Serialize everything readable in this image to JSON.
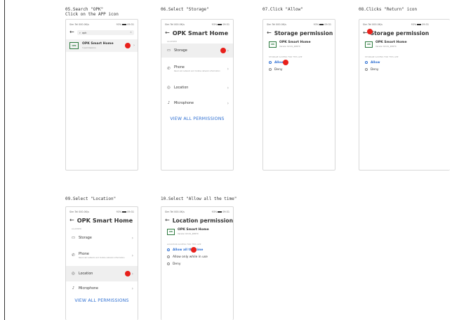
{
  "status_bar": {
    "left": "Sim Tel  000.0K/s",
    "right": "93%",
    "right_short": "93%"
  },
  "steps": [
    {
      "caption_lines": [
        "05.Search \"OPK\"",
        "Click on the APP icon"
      ],
      "search": {
        "value": "opk",
        "clear_icon": "close-icon"
      },
      "result": {
        "logo_text": "OPK",
        "name": "OPK Smart Home",
        "sub": "3 permissions"
      }
    },
    {
      "caption_lines": [
        "06.Select \"Storage\""
      ],
      "title": "OPK Smart Home",
      "section": "ALLOWED",
      "permissions": [
        {
          "label": "Storage",
          "desc": "",
          "icon": "folder-icon"
        },
        {
          "label": "Phone",
          "desc": "Read cell network and mobile network information",
          "icon": "phone-icon"
        },
        {
          "label": "Location",
          "desc": "",
          "icon": "location-icon"
        },
        {
          "label": "Microphone",
          "desc": "",
          "icon": "microphone-icon"
        }
      ],
      "view_all": "VIEW ALL PERMISSIONS"
    },
    {
      "caption_lines": [
        "07.Click \"Allow\""
      ],
      "title": "Storage permission",
      "app": {
        "logo_text": "OPK",
        "name": "OPK Smart Home",
        "sub": "Version 02.01_20870"
      },
      "section": "STORAGE ACCESS FOR THIS APP",
      "options": [
        "Allow",
        "Deny"
      ],
      "selected": 0
    },
    {
      "caption_lines": [
        "08.Clicks \"Return\" icon"
      ],
      "title": "Storage permission",
      "app": {
        "logo_text": "OPK",
        "name": "OPK Smart Home",
        "sub": "Version 02.01_20870"
      },
      "section": "STORAGE ACCESS FOR THIS APP",
      "options": [
        "Allow",
        "Deny"
      ],
      "selected": 0
    },
    {
      "caption_lines": [
        "09.Select \"Location\""
      ],
      "title": "OPK Smart Home",
      "section": "ALLOWED",
      "permissions": [
        {
          "label": "Storage",
          "desc": "",
          "icon": "folder-icon"
        },
        {
          "label": "Phone",
          "desc": "Read cell network and mobile network information",
          "icon": "phone-icon"
        },
        {
          "label": "Location",
          "desc": "",
          "icon": "location-icon"
        },
        {
          "label": "Microphone",
          "desc": "",
          "icon": "microphone-icon"
        }
      ],
      "view_all": "VIEW ALL PERMISSIONS"
    },
    {
      "caption_lines": [
        "10.Select \"Allow all the time\""
      ],
      "title": "Location permission",
      "app": {
        "logo_text": "OPK",
        "name": "OPK Smart Home",
        "sub": "Version 02.01_20870"
      },
      "section": "LOCATION ACCESS FOR THIS APP",
      "options": [
        "Allow all the time",
        "Allow only while in use",
        "Deny"
      ],
      "selected": 0
    }
  ],
  "colors": {
    "accent": "#2e6fd2",
    "tap_marker": "#e8201b",
    "brand_green": "#2c7a3e"
  }
}
